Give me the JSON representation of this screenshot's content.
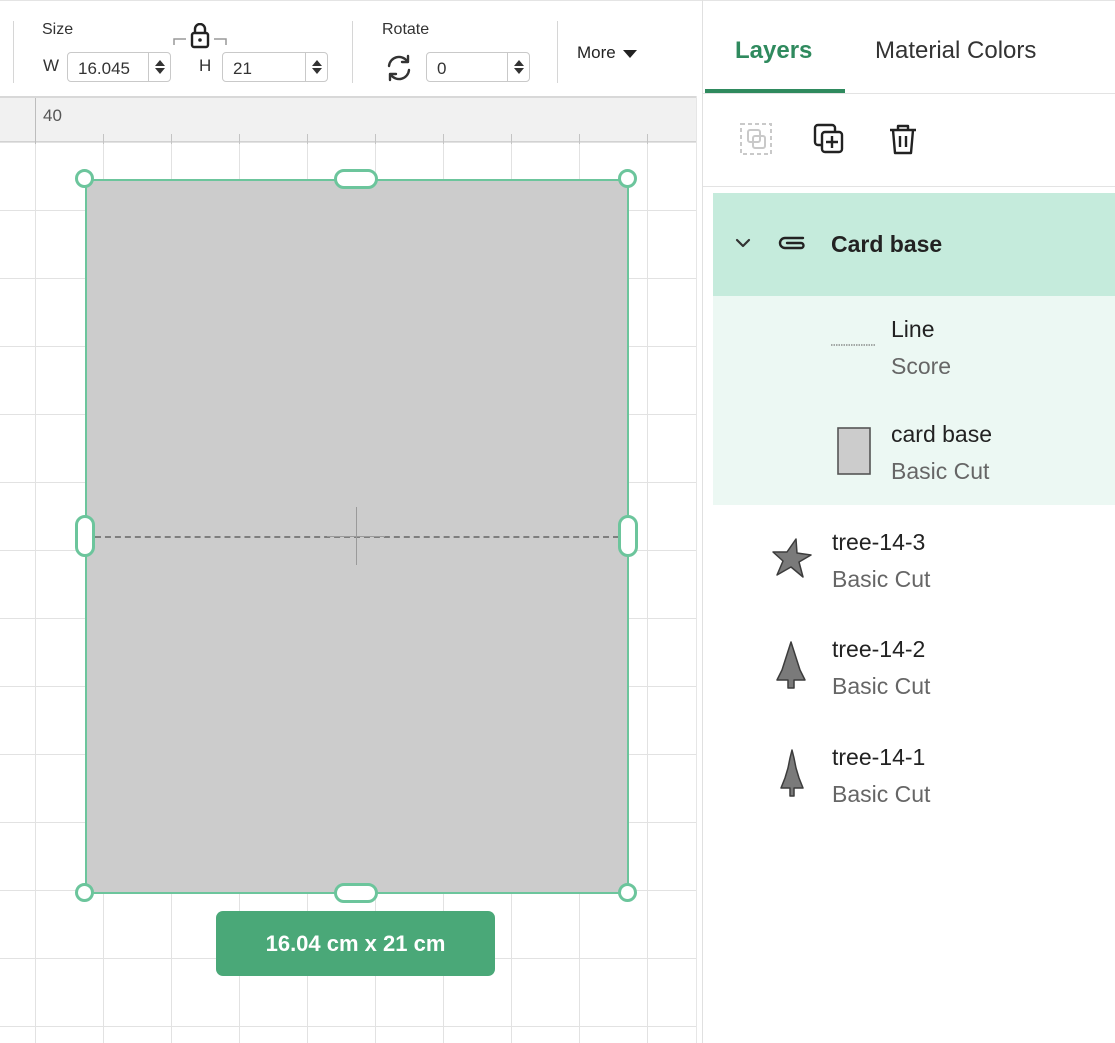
{
  "toolbar": {
    "size_label": "Size",
    "width_prefix": "W",
    "width_value": "16.045",
    "height_prefix": "H",
    "height_value": "21",
    "rotate_label": "Rotate",
    "rotate_value": "0",
    "more_label": "More"
  },
  "canvas": {
    "ruler_label": "40",
    "dimension_badge": "16.04  cm x 21  cm",
    "shape_fill": "#cccccc",
    "selection_color": "#6cc59c"
  },
  "panel": {
    "tabs": [
      {
        "label": "Layers",
        "active": true
      },
      {
        "label": "Material Colors",
        "active": false
      }
    ],
    "actions": [
      {
        "icon": "group-icon",
        "enabled": false
      },
      {
        "icon": "duplicate-icon",
        "enabled": true
      },
      {
        "icon": "trash-icon",
        "enabled": true
      }
    ],
    "group": {
      "name": "Card base",
      "icon": "attach-icon",
      "expanded": true
    },
    "children": [
      {
        "name": "Line",
        "operation": "Score",
        "icon": "score-line-icon"
      },
      {
        "name": "card base",
        "operation": "Basic Cut",
        "icon": "rectangle-icon"
      }
    ],
    "layers": [
      {
        "name": "tree-14-3",
        "operation": "Basic Cut",
        "icon": "star-icon"
      },
      {
        "name": "tree-14-2",
        "operation": "Basic Cut",
        "icon": "tree-icon"
      },
      {
        "name": "tree-14-1",
        "operation": "Basic Cut",
        "icon": "tree-slim-icon"
      }
    ]
  },
  "colors": {
    "accent": "#2f8a5e",
    "badge": "#4aa878",
    "group_highlight": "#c5ebdc",
    "child_highlight": "#ecf8f3"
  }
}
